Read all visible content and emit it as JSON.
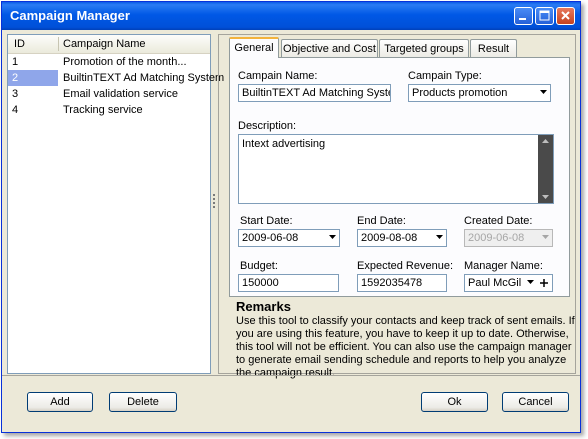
{
  "window": {
    "title": "Campaign Manager"
  },
  "list": {
    "columns": [
      "ID",
      "Campaign Name"
    ],
    "rows": [
      {
        "id": "1",
        "name": "Promotion of the month..."
      },
      {
        "id": "2",
        "name": "BuiltinTEXT Ad Matching System"
      },
      {
        "id": "3",
        "name": "Email validation service"
      },
      {
        "id": "4",
        "name": "Tracking service"
      }
    ],
    "selected_index": 1
  },
  "tabs": [
    "General",
    "Objective and Cost",
    "Targeted groups",
    "Result"
  ],
  "form": {
    "campaign_name_label": "Campain Name:",
    "campaign_name_value": "BuiltinTEXT Ad Matching System",
    "campaign_type_label": "Campain Type:",
    "campaign_type_value": "Products promotion",
    "description_label": "Description:",
    "description_value": "Intext advertising",
    "start_date_label": "Start Date:",
    "start_date_value": "2009-06-08",
    "end_date_label": "End Date:",
    "end_date_value": "2009-08-08",
    "created_date_label": "Created Date:",
    "created_date_value": "2009-06-08",
    "budget_label": "Budget:",
    "budget_value": "150000",
    "expected_revenue_label": "Expected Revenue:",
    "expected_revenue_value": "1592035478",
    "manager_name_label": "Manager Name:",
    "manager_name_value": "Paul McGil"
  },
  "remarks": {
    "title": "Remarks",
    "text": "Use this tool to classify your contacts and keep track of sent emails. If you are using this feature, you have to keep it up to date. Otherwise, this tool will not be efficient. You can also use the campaign manager to generate email sending schedule and reports to help you analyze the campaign result."
  },
  "buttons": {
    "add": "Add",
    "delete": "Delete",
    "ok": "Ok",
    "cancel": "Cancel"
  },
  "icons": {
    "minimize": "minimize-icon",
    "maximize": "maximize-icon",
    "close": "close-icon"
  },
  "colors": {
    "title_bar": "#0058e6",
    "selection": "#8fa6ea",
    "active_tab_accent": "#f3b33d"
  }
}
